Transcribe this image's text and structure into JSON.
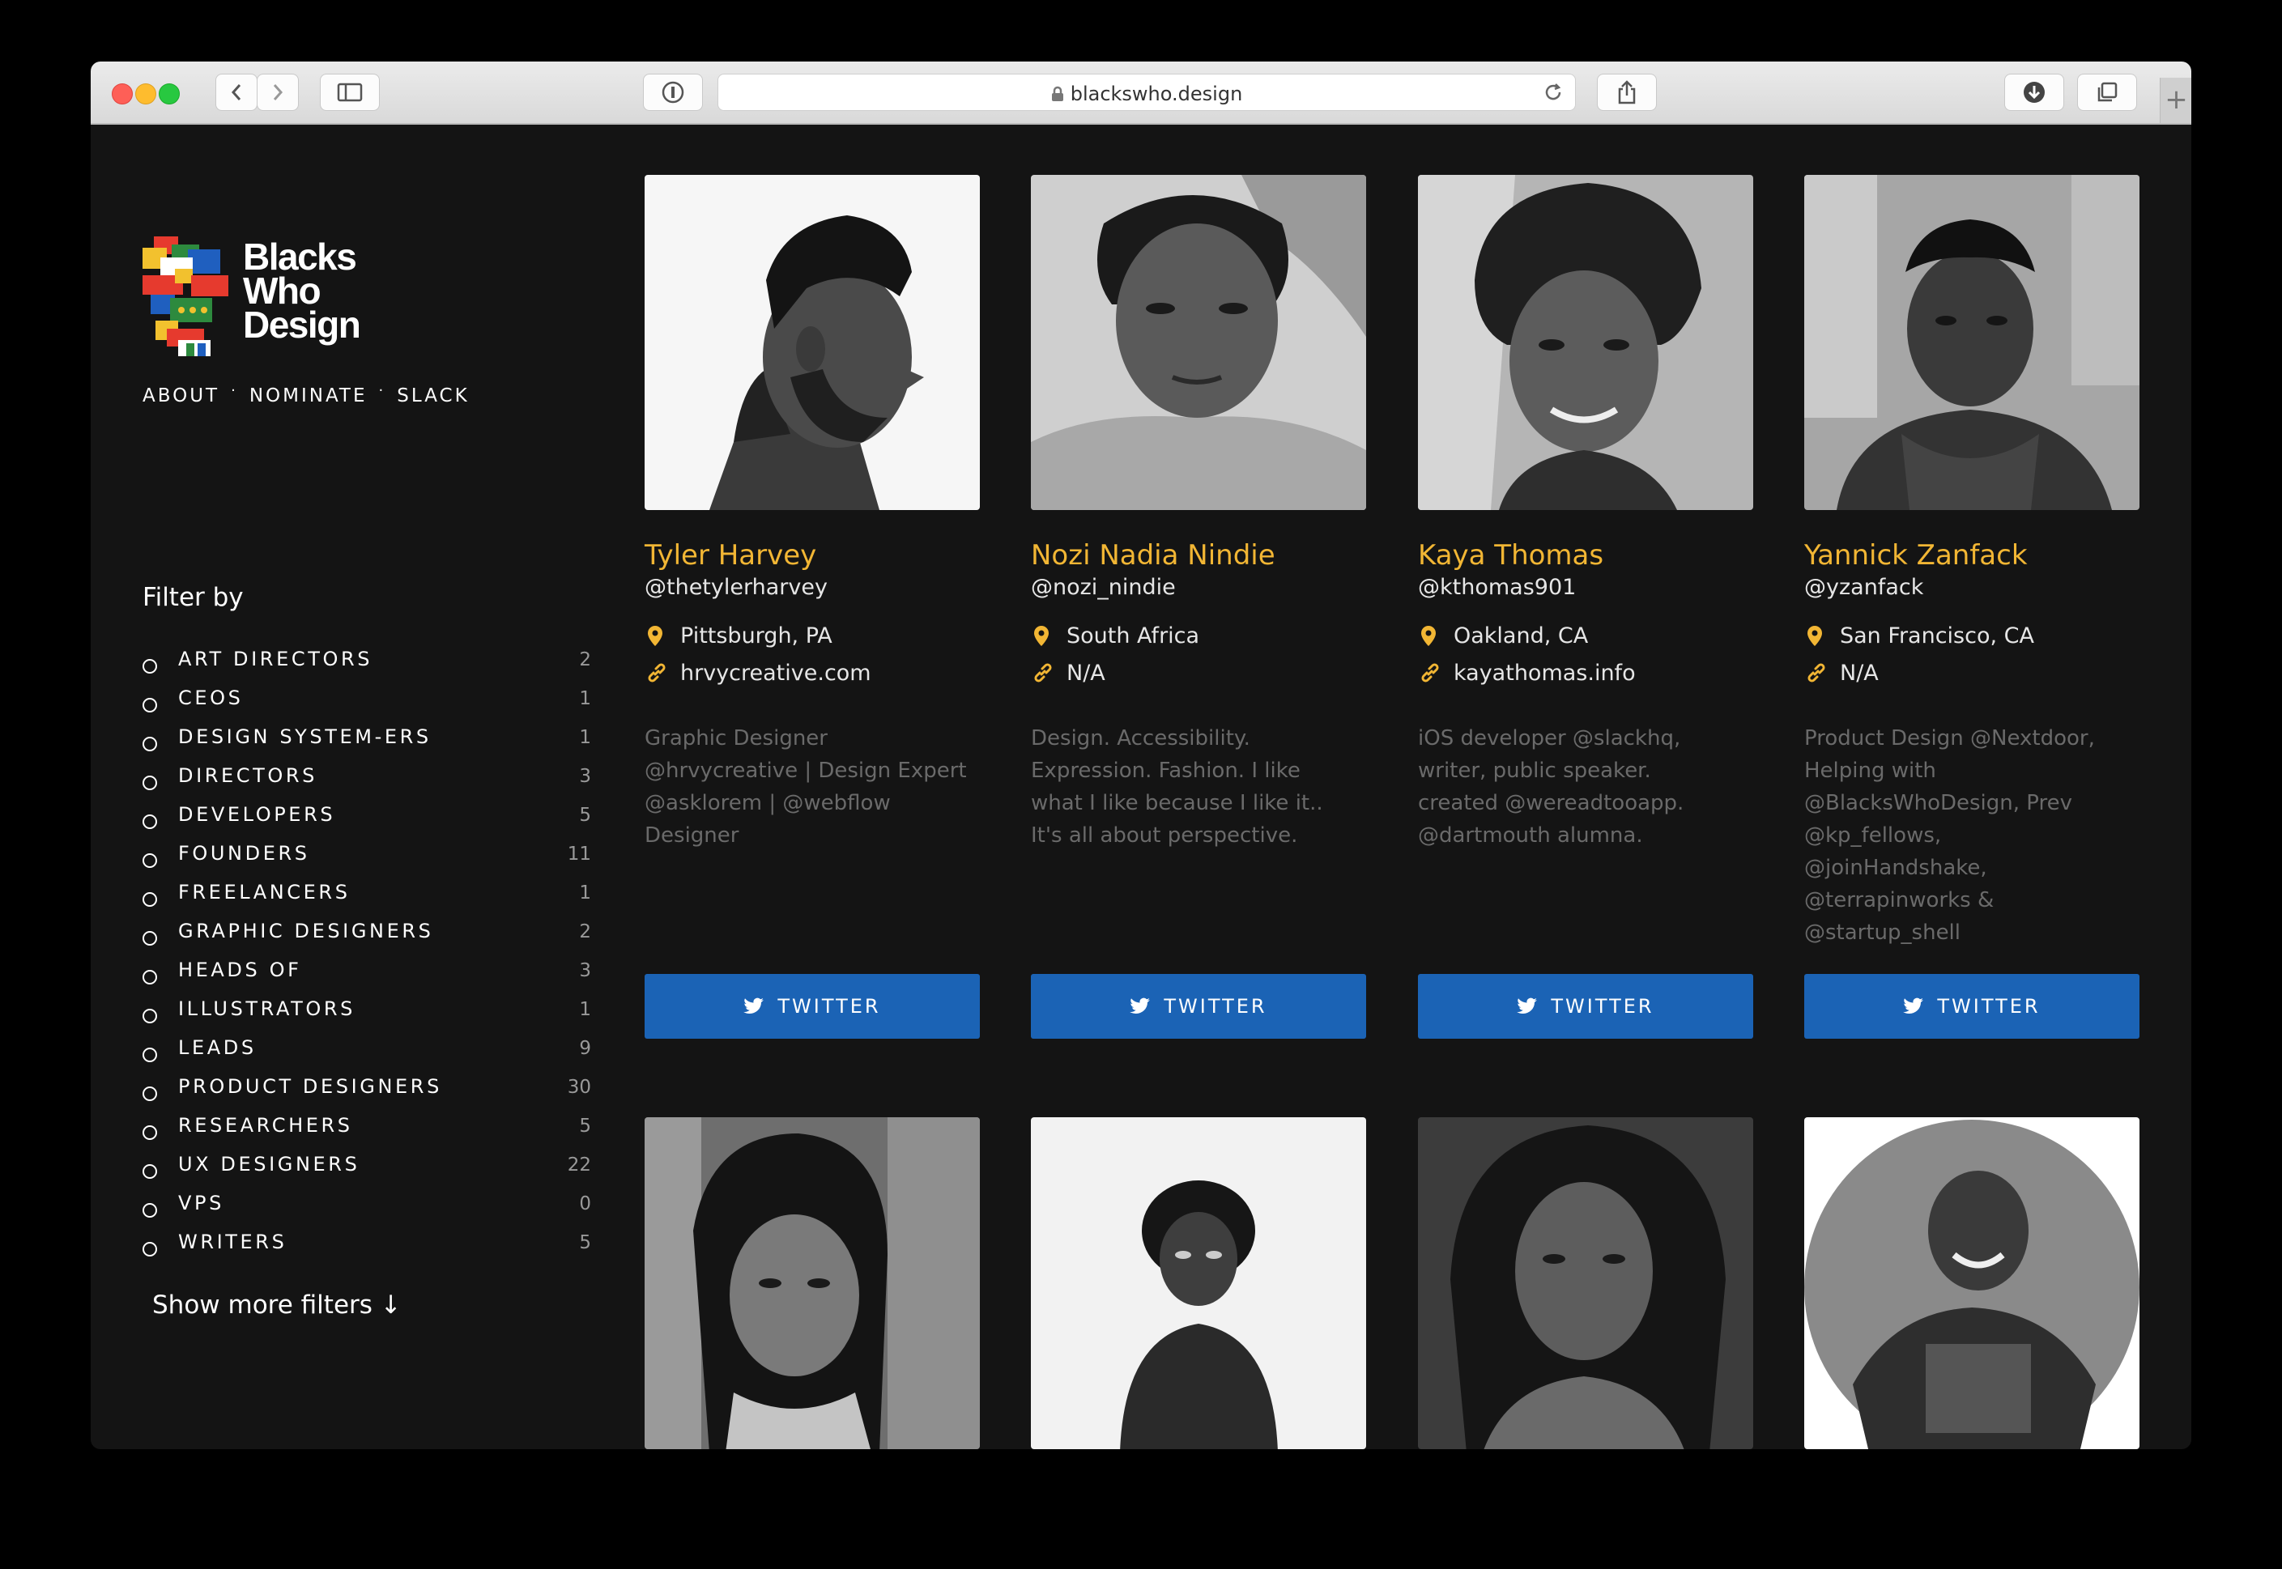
{
  "browser": {
    "url": "blackswho.design"
  },
  "site": {
    "logo_lines": [
      "Blacks",
      "Who",
      "Design"
    ],
    "nav": [
      "ABOUT",
      "NOMINATE",
      "SLACK"
    ],
    "nav_separator": "·"
  },
  "filters": {
    "title": "Filter by",
    "items": [
      {
        "label": "ART DIRECTORS",
        "count": "2"
      },
      {
        "label": "CEOS",
        "count": "1"
      },
      {
        "label": "DESIGN SYSTEM-ERS",
        "count": "1"
      },
      {
        "label": "DIRECTORS",
        "count": "3"
      },
      {
        "label": "DEVELOPERS",
        "count": "5"
      },
      {
        "label": "FOUNDERS",
        "count": "11"
      },
      {
        "label": "FREELANCERS",
        "count": "1"
      },
      {
        "label": "GRAPHIC DESIGNERS",
        "count": "2"
      },
      {
        "label": "HEADS OF",
        "count": "3"
      },
      {
        "label": "ILLUSTRATORS",
        "count": "1"
      },
      {
        "label": "LEADS",
        "count": "9"
      },
      {
        "label": "PRODUCT DESIGNERS",
        "count": "30"
      },
      {
        "label": "RESEARCHERS",
        "count": "5"
      },
      {
        "label": "UX DESIGNERS",
        "count": "22"
      },
      {
        "label": "VPS",
        "count": "0"
      },
      {
        "label": "WRITERS",
        "count": "5"
      }
    ],
    "show_more": "Show more filters ↓"
  },
  "cards": [
    {
      "name": "Tyler Harvey",
      "handle": "@thetylerharvey",
      "location": "Pittsburgh, PA",
      "website": "hrvycreative.com",
      "bio": [
        "Graphic Designer",
        "@hrvycreative | Design Expert",
        "@asklorem | @webflow",
        "Designer"
      ],
      "button": "TWITTER"
    },
    {
      "name": "Nozi Nadia Nindie",
      "handle": "@nozi_nindie",
      "location": "South Africa",
      "website": "N/A",
      "bio": [
        "Design. Accessibility.",
        "Expression. Fashion. I like",
        "what I like because I like it..",
        "It's all about perspective."
      ],
      "button": "TWITTER"
    },
    {
      "name": "Kaya Thomas",
      "handle": "@kthomas901",
      "location": "Oakland, CA",
      "website": "kayathomas.info",
      "bio": [
        "iOS developer @slackhq,",
        "writer, public speaker.",
        "created @wereadtooapp.",
        "@dartmouth alumna."
      ],
      "button": "TWITTER"
    },
    {
      "name": "Yannick Zanfack",
      "handle": "@yzanfack",
      "location": "San Francisco, CA",
      "website": "N/A",
      "bio": [
        "Product Design @Nextdoor,",
        "Helping with",
        "@BlacksWhoDesign, Prev",
        "@kp_fellows,",
        "@joinHandshake,",
        "@terrapinworks &",
        "@startup_shell"
      ],
      "button": "TWITTER"
    }
  ],
  "colors": {
    "accent": "#f2b634",
    "twitter": "#1b63b5",
    "background": "#141414"
  }
}
